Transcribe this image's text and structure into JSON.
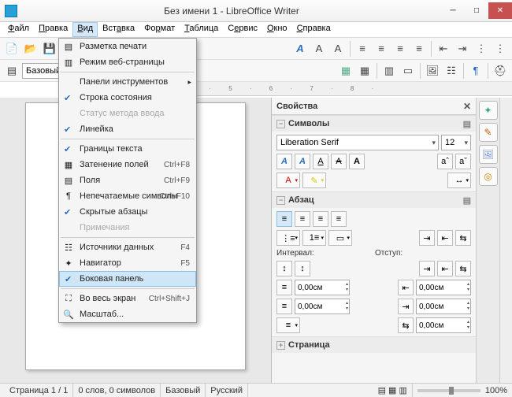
{
  "titlebar": {
    "title": "Без имени 1 - LibreOffice Writer"
  },
  "menubar": {
    "items": [
      "Файл",
      "Правка",
      "Вид",
      "Вставка",
      "Формат",
      "Таблица",
      "Сервис",
      "Окно",
      "Справка"
    ]
  },
  "toolbar1": {
    "style_combo": "Базовый"
  },
  "dropdown": {
    "items": [
      {
        "label": "Разметка печати",
        "icon": "▤"
      },
      {
        "label": "Режим веб-страницы",
        "icon": "▥"
      },
      {
        "sep": true
      },
      {
        "label": "Панели инструментов",
        "submenu": true
      },
      {
        "label": "Строка состояния",
        "checked": true
      },
      {
        "label": "Статус метода ввода",
        "disabled": true
      },
      {
        "label": "Линейка",
        "checked": true
      },
      {
        "sep": true
      },
      {
        "label": "Границы текста",
        "checked": true
      },
      {
        "label": "Затенение полей",
        "icon": "▦",
        "shortcut": "Ctrl+F8"
      },
      {
        "label": "Поля",
        "icon": "▤",
        "shortcut": "Ctrl+F9"
      },
      {
        "label": "Непечатаемые символы",
        "icon": "¶",
        "shortcut": "Ctrl+F10"
      },
      {
        "label": "Скрытые абзацы",
        "checked": true
      },
      {
        "label": "Примечания",
        "disabled": true
      },
      {
        "sep": true
      },
      {
        "label": "Источники данных",
        "icon": "☷",
        "shortcut": "F4"
      },
      {
        "label": "Навигатор",
        "icon": "✦",
        "shortcut": "F5"
      },
      {
        "label": "Боковая панель",
        "checked": true,
        "highlighted": true
      },
      {
        "sep": true
      },
      {
        "label": "Во весь экран",
        "icon": "⛶",
        "shortcut": "Ctrl+Shift+J"
      },
      {
        "label": "Масштаб...",
        "icon": "🔍"
      }
    ]
  },
  "sidebar": {
    "title": "Свойства",
    "sections": {
      "symbols": {
        "title": "Символы",
        "font_combo": "Liberation Serif",
        "size_combo": "12"
      },
      "paragraph": {
        "title": "Абзац",
        "interval_label": "Интервал:",
        "indent_label": "Отступ:",
        "spacings": [
          "0,00см",
          "0,00см",
          "0,00см",
          "0,00см",
          "0,00см"
        ]
      },
      "page": {
        "title": "Страница"
      }
    }
  },
  "statusbar": {
    "page": "Страница 1 / 1",
    "words": "0 слов, 0 символов",
    "style": "Базовый",
    "lang": "Русский",
    "zoom": "100%"
  },
  "ruler": "1 · 2 · 3 · 4 · 5 · 6 · 7 · 8 ·"
}
